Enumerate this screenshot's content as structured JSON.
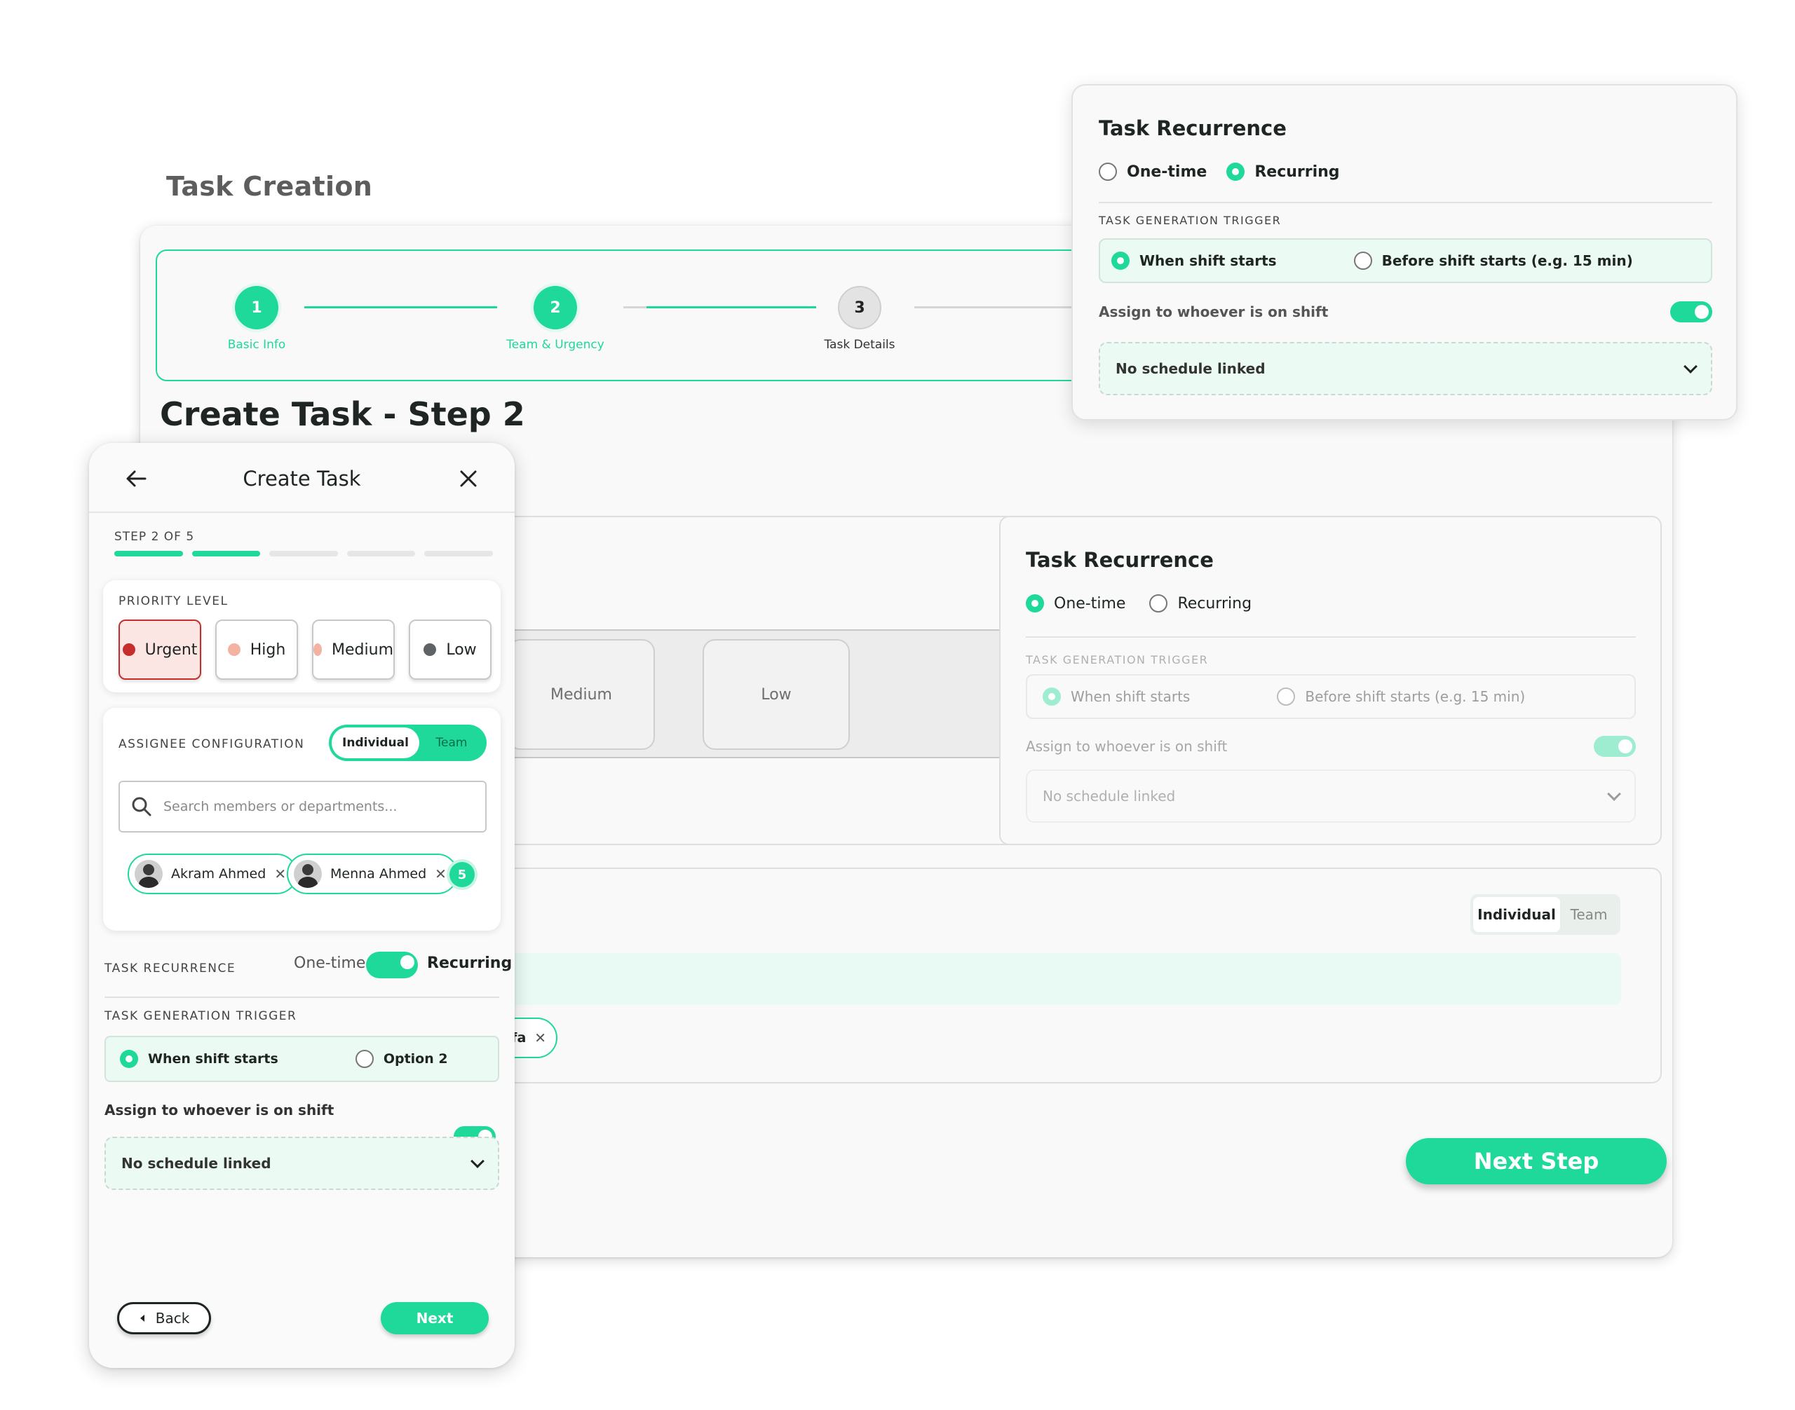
{
  "section_title": "Task Creation",
  "stepper": {
    "steps": [
      {
        "number": "1",
        "label": "Basic Info"
      },
      {
        "number": "2",
        "label": "Team & Urgency"
      },
      {
        "number": "3",
        "label": "Task Details"
      }
    ]
  },
  "main": {
    "title": "Create Task - Step 2",
    "priority_options": [
      "Medium",
      "Low"
    ],
    "recurrence": {
      "title": "Task Recurrence",
      "option_one_time": "One-time",
      "option_recurring": "Recurring",
      "selected": "One-time",
      "trigger_label": "TASK GENERATION TRIGGER",
      "trigger_option_1": "When shift starts",
      "trigger_option_2": "Before shift starts (e.g. 15 min)",
      "assign_label": "Assign to whoever is on shift",
      "assign_on": true,
      "schedule_placeholder": "No schedule linked"
    },
    "assignee": {
      "toggle_individual": "Individual",
      "toggle_team": "Team",
      "chip_partial": "Mostafa"
    },
    "next_button": "Next Step"
  },
  "floating_recurrence": {
    "title": "Task Recurrence",
    "option_one_time": "One-time",
    "option_recurring": "Recurring",
    "selected": "Recurring",
    "trigger_label": "TASK GENERATION TRIGGER",
    "trigger_option_1": "When shift starts",
    "trigger_option_2": "Before shift starts (e.g. 15 min)",
    "assign_label": "Assign to whoever is on shift",
    "assign_on": true,
    "schedule_placeholder": "No schedule linked"
  },
  "mobile": {
    "title": "Create Task",
    "step_text": "STEP 2 OF 5",
    "progress": {
      "current": 2,
      "total": 5
    },
    "priority": {
      "label": "PRIORITY LEVEL",
      "options": [
        {
          "label": "Urgent",
          "color": "#c62d2d",
          "selected": true
        },
        {
          "label": "High",
          "color": "#f4b2a3",
          "selected": false
        },
        {
          "label": "Medium",
          "color": "#f4b2a3",
          "selected": false
        },
        {
          "label": "Low",
          "color": "#5e6466",
          "selected": false
        }
      ]
    },
    "assignee": {
      "label": "ASSIGNEE CONFIGURATION",
      "toggle_individual": "Individual",
      "toggle_team": "Team",
      "search_placeholder": "Search members or departments...",
      "chips": [
        "Akram Ahmed",
        "Menna Ahmed"
      ],
      "more_count": "5"
    },
    "recurrence": {
      "label": "TASK RECURRENCE",
      "option_one_time": "One-time",
      "option_recurring": "Recurring",
      "trigger_label": "TASK GENERATION TRIGGER",
      "trigger_option_1": "When shift starts",
      "trigger_option_2": "Option 2",
      "assign_label": "Assign to whoever is on shift",
      "schedule_placeholder": "No schedule linked"
    },
    "back_button": "Back",
    "next_button": "Next"
  },
  "colors": {
    "accent": "#1ed99a",
    "accent_light": "#9eedd1",
    "urgent": "#c62d2d",
    "surface": "#f8f9f8"
  },
  "icons": [
    "back-arrow-icon",
    "close-icon",
    "search-icon",
    "chevron-down-icon",
    "remove-chip-icon",
    "caret-left-icon"
  ]
}
